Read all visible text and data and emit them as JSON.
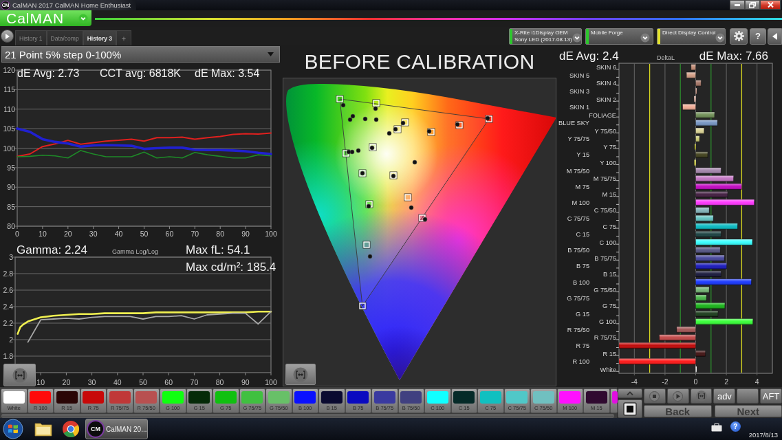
{
  "title_bar": {
    "icon_text": "CM",
    "title": "CalMAN 2017 CalMAN Home Enthusiast"
  },
  "app_bar": {
    "logo": "CalMAN"
  },
  "tabs": [
    {
      "label": "History 1",
      "selected": false
    },
    {
      "label": "Data/comp",
      "selected": false
    },
    {
      "label": "History 3",
      "selected": true
    }
  ],
  "add_tab": "+",
  "devices": [
    {
      "lines": [
        "X-Rite i1Display OEM",
        "Sony LED (2017.08.13)"
      ],
      "color": "#2ec62e"
    },
    {
      "lines": [
        "Mobile Forge"
      ],
      "color": "#2ec62e"
    },
    {
      "lines": [
        "Direct Display Control"
      ],
      "color": "#e2e22a"
    }
  ],
  "help_button": "?",
  "workflow": {
    "selector": "21 Point 5% step 0-100%"
  },
  "rgb_balance": {
    "stats": [
      "dE Avg: 2.73",
      "CCT avg: 6818K",
      "dE Max: 3.54"
    ],
    "chart_data": {
      "type": "line",
      "x": [
        0,
        5,
        10,
        15,
        20,
        25,
        30,
        35,
        40,
        45,
        50,
        55,
        60,
        65,
        70,
        75,
        80,
        85,
        90,
        95,
        100
      ],
      "series": [
        {
          "color": "#e0201e",
          "values": [
            97.9,
            98.5,
            100.4,
            101.1,
            102.0,
            101.0,
            101.4,
            101.8,
            102.0,
            102.3,
            101.8,
            102.7,
            102.7,
            102.8,
            102.3,
            102.7,
            103.0,
            103.5,
            103.7,
            103.6,
            103.9
          ]
        },
        {
          "color": "#1e8a28",
          "values": [
            97.8,
            97.9,
            98.2,
            98.0,
            97.5,
            99.4,
            98.5,
            97.8,
            97.8,
            97.8,
            99.0,
            97.5,
            97.8,
            97.5,
            98.9,
            98.3,
            97.9,
            97.5,
            97.5,
            98.3,
            98.0
          ]
        },
        {
          "color": "#2020d0",
          "values": [
            105.0,
            104.2,
            102.3,
            101.6,
            101.2,
            100.4,
            100.7,
            100.8,
            100.7,
            100.6,
            99.8,
            100.0,
            100.1,
            100.1,
            99.6,
            99.5,
            99.5,
            99.4,
            99.2,
            98.8,
            98.5
          ]
        }
      ],
      "xlim": [
        0,
        100
      ],
      "ylim": [
        80,
        120
      ],
      "xticks": [
        0,
        10,
        20,
        30,
        40,
        50,
        60,
        70,
        80,
        90,
        100
      ],
      "yticks": [
        80,
        85,
        90,
        95,
        100,
        105,
        110,
        115,
        120
      ],
      "grid": true
    }
  },
  "gamma": {
    "readout": "Gamma: 2.24",
    "caption": "Gamma Log/Log",
    "max_fl": "Max fL: 54.1",
    "max_cd": "Max cd/m²: 185.4",
    "chart_data": {
      "type": "line",
      "x": [
        1,
        2,
        3,
        5,
        10,
        15,
        20,
        25,
        30,
        35,
        40,
        45,
        50,
        55,
        60,
        65,
        70,
        75,
        80,
        85,
        90,
        95,
        100
      ],
      "series": [
        {
          "color": "#f0f050",
          "values": [
            2.07,
            2.15,
            2.18,
            2.22,
            2.27,
            2.29,
            2.3,
            2.31,
            2.31,
            2.32,
            2.32,
            2.32,
            2.32,
            2.33,
            2.33,
            2.33,
            2.33,
            2.33,
            2.33,
            2.33,
            2.33,
            2.34,
            2.34
          ]
        },
        {
          "color": "#a8a8a8",
          "values": [
            null,
            null,
            null,
            1.97,
            2.24,
            2.25,
            2.26,
            2.25,
            2.27,
            2.28,
            2.28,
            2.28,
            2.25,
            2.28,
            2.28,
            2.29,
            2.25,
            2.3,
            2.31,
            2.32,
            2.32,
            2.19,
            2.34
          ]
        }
      ],
      "xlim": [
        0,
        100
      ],
      "ylim": [
        1.6,
        3
      ],
      "xticks": [
        10,
        20,
        30,
        40,
        50,
        60,
        70,
        80,
        90,
        100
      ],
      "yticks": [
        1.8,
        2,
        2.2,
        2.4,
        2.6,
        2.8,
        3
      ],
      "grid": true
    }
  },
  "cie": {
    "title": "BEFORE CALIBRATION"
  },
  "deltal": {
    "avg": "dE Avg: 2.4",
    "max": "dE Max: 7.66",
    "chart_data": {
      "type": "bar",
      "orientation": "horizontal",
      "title": "DeltaL",
      "categories": [
        "SKIN 6",
        "SKIN 5",
        "SKIN 4",
        "SKIN 3",
        "SKIN 2",
        "SKIN 1",
        "FOLIAGE",
        "BLUE SKY",
        "Y 75/50",
        "Y 75/75",
        "Y 75",
        "Y 15",
        "Y 100",
        "M 75/50",
        "M 75/75",
        "M 75",
        "M 15",
        "M 100",
        "C 75/50",
        "C 75/75",
        "C 75",
        "C 15",
        "C 100",
        "B 75/50",
        "B 75/75",
        "B 75",
        "B 15",
        "B 100",
        "G 75/50",
        "G 75/75",
        "G 75",
        "G 15",
        "G 100",
        "R 75/50",
        "R 75/75",
        "R 75",
        "R 15",
        "R 100",
        "White"
      ],
      "series": [
        {
          "values": [
            -0.3,
            -0.6,
            0.35,
            0.03,
            -0.1,
            -0.85,
            1.23,
            1.42,
            0.55,
            0.25,
            -0.05,
            0.78,
            -0.08,
            1.65,
            2.47,
            3.0,
            2.08,
            3.82,
            0.88,
            1.15,
            2.73,
            1.65,
            3.7,
            1.6,
            1.87,
            2.02,
            1.65,
            3.63,
            0.88,
            0.7,
            1.9,
            1.45,
            3.73,
            -1.24,
            -2.37,
            -5.0,
            0.63,
            -5.0,
            0
          ],
          "colors": [
            "#c08870",
            "#d09a80",
            "#a07060",
            "#c09080",
            "#e0b0a0",
            "#f0a890",
            "#6a8a50",
            "#7090c0",
            "#d8d090",
            "#c8c870",
            "#c0c000",
            "#3a3a14",
            "#ffff40",
            "#a080a8",
            "#c070c0",
            "#c000c0",
            "#3a1438",
            "#ff30ff",
            "#80b0b8",
            "#60c0c0",
            "#00b8c0",
            "#123a3a",
            "#30ffff",
            "#505080",
            "#404098",
            "#1010b8",
            "#101034",
            "#1030ff",
            "#70b070",
            "#40b040",
            "#10b010",
            "#123412",
            "#30ff30",
            "#a05050",
            "#c04040",
            "#c00000",
            "#3a0a0a",
            "#ff1010",
            "#e8e8e8"
          ]
        }
      ],
      "xlim": [
        -5,
        5
      ],
      "xticks": [
        -4,
        -2,
        0,
        2,
        4
      ],
      "grid": true,
      "ref_lines": [
        {
          "axis": "x",
          "value": -3,
          "color": "#d8d820"
        },
        {
          "axis": "x",
          "value": 3,
          "color": "#d8d820"
        },
        {
          "axis": "x",
          "value": -1,
          "color": "#2e8a2e"
        },
        {
          "axis": "x",
          "value": 1,
          "color": "#2e8a2e"
        }
      ]
    }
  },
  "swatches": [
    {
      "label": "White",
      "color": "#ffffff"
    },
    {
      "label": "R 100",
      "color": "#ff0a0a"
    },
    {
      "label": "R 15",
      "color": "#2a0505"
    },
    {
      "label": "R 75",
      "color": "#c80808"
    },
    {
      "label": "R 75/75",
      "color": "#c03838"
    },
    {
      "label": "R 75/50",
      "color": "#b85050"
    },
    {
      "label": "G 100",
      "color": "#10ff10"
    },
    {
      "label": "G 15",
      "color": "#052a08"
    },
    {
      "label": "G 75",
      "color": "#10c010"
    },
    {
      "label": "G 75/75",
      "color": "#40c040"
    },
    {
      "label": "G 75/50",
      "color": "#68c068"
    },
    {
      "label": "B 100",
      "color": "#0a10ff"
    },
    {
      "label": "B 15",
      "color": "#0a0a30"
    },
    {
      "label": "B 75",
      "color": "#0a0ac0"
    },
    {
      "label": "B 75/75",
      "color": "#3a3aa0"
    },
    {
      "label": "B 75/50",
      "color": "#404080"
    },
    {
      "label": "C 100",
      "color": "#10ffff"
    },
    {
      "label": "C 15",
      "color": "#052a28"
    },
    {
      "label": "C 75",
      "color": "#10c0c0"
    },
    {
      "label": "C 75/75",
      "color": "#50c8c8"
    },
    {
      "label": "C 75/50",
      "color": "#70c0c0"
    },
    {
      "label": "M 100",
      "color": "#ff10ff"
    },
    {
      "label": "M 15",
      "color": "#300a30"
    },
    {
      "color": "#e010e0"
    }
  ],
  "controls": {
    "adv": "adv",
    "aft": "AFT",
    "nav": [
      "Back",
      "Next"
    ]
  },
  "taskbar": {
    "task_icon_text": "CM",
    "task": "CalMAN 20...",
    "help_glyph": "?",
    "date": "2017/8/13"
  }
}
